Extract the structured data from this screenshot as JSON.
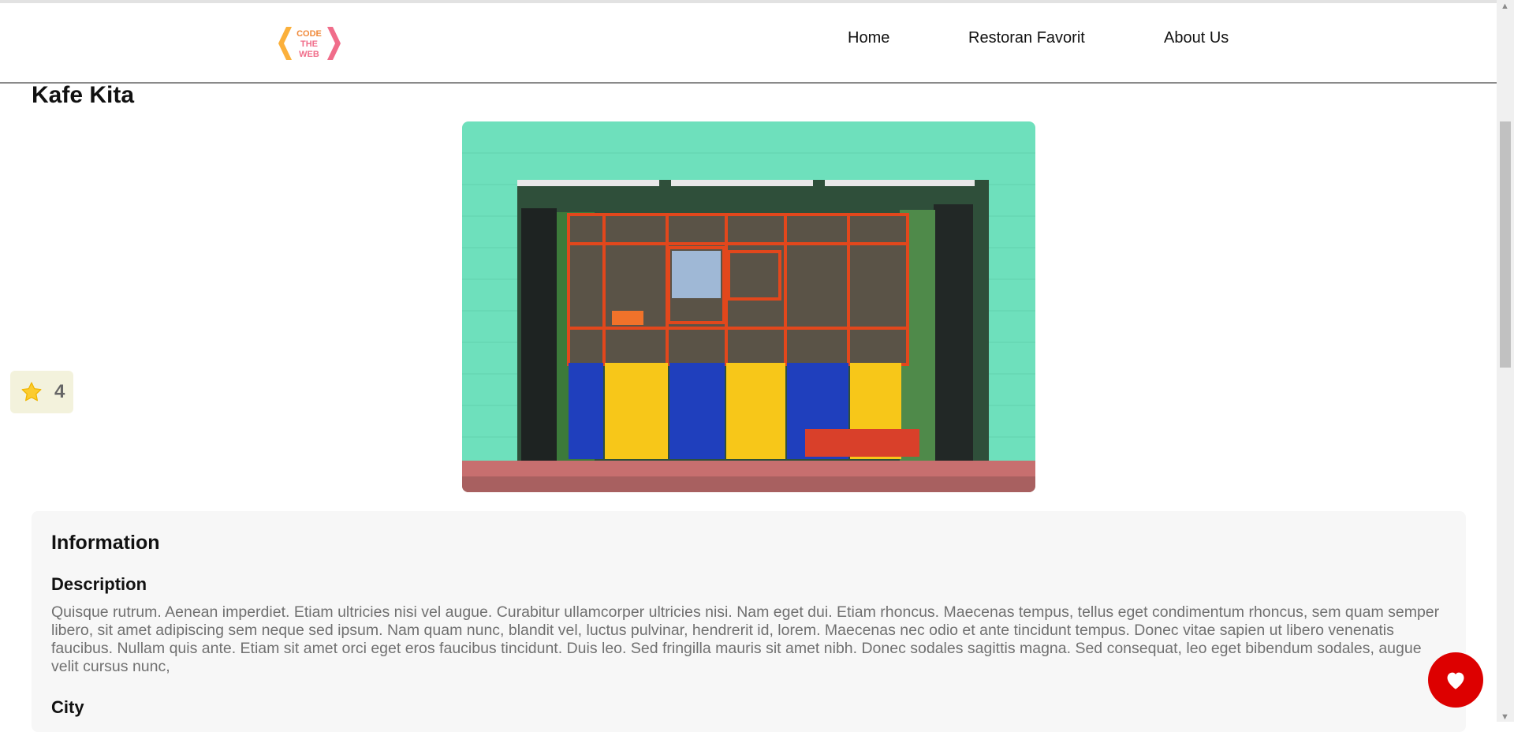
{
  "header": {
    "logo_text": [
      "CODE",
      "THE",
      "WEB"
    ],
    "nav": [
      {
        "label": "Home"
      },
      {
        "label": "Restoran Favorit"
      },
      {
        "label": "About Us"
      }
    ]
  },
  "restaurant": {
    "name": "Kafe Kita",
    "rating": "4"
  },
  "info": {
    "heading": "Information",
    "description_heading": "Description",
    "description": "Quisque rutrum. Aenean imperdiet. Etiam ultricies nisi vel augue. Curabitur ullamcorper ultricies nisi. Nam eget dui. Etiam rhoncus. Maecenas tempus, tellus eget condimentum rhoncus, sem quam semper libero, sit amet adipiscing sem neque sed ipsum. Nam quam nunc, blandit vel, luctus pulvinar, hendrerit id, lorem. Maecenas nec odio et ante tincidunt tempus. Donec vitae sapien ut libero venenatis faucibus. Nullam quis ante. Etiam sit amet orci eget eros faucibus tincidunt. Duis leo. Sed fringilla mauris sit amet nibh. Donec sodales sagittis magna. Sed consequat, leo eget bibendum sodales, augue velit cursus nunc,",
    "city_heading": "City"
  },
  "colors": {
    "favorite_button": "#dd0000",
    "star": "#fccc2f",
    "rating_bg": "#f3f2dc",
    "card_bg": "#f7f7f7"
  },
  "icons": {
    "rating": "star-icon",
    "favorite": "heart-icon"
  }
}
